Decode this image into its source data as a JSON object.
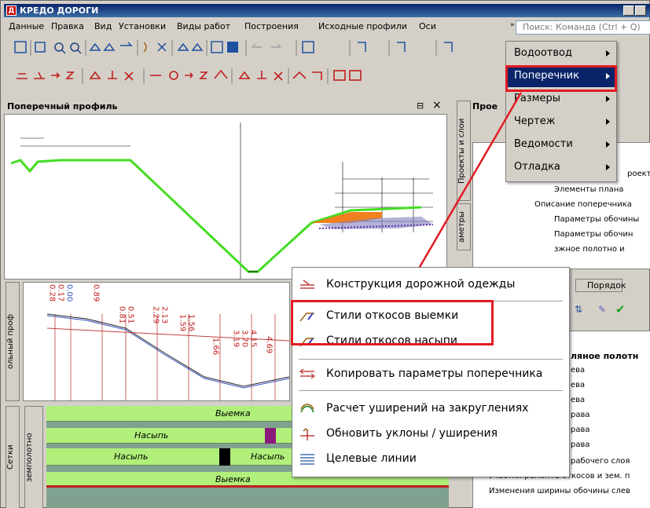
{
  "app": {
    "title": "КРЕДО ДОРОГИ",
    "icon_letter": "Д"
  },
  "menu": [
    "Данные",
    "Правка",
    "Вид",
    "Установки",
    "Виды работ",
    "Построения",
    "Исходные профили",
    "Оси"
  ],
  "search": {
    "placeholder": "Поиск: Команда (Ctrl + Q)"
  },
  "profile_panel": {
    "title": "Поперечный профиль",
    "pin": "⊟",
    "close": "×"
  },
  "right_panel": {
    "title": "Прое",
    "vtab_projects": "Проекты и слои",
    "vtab_params": "аметры",
    "tab_order": "Порядок"
  },
  "tree": {
    "items": [
      "роекта",
      "Элементы плана",
      "Описание поперечника",
      "Параметры обочины",
      "Параметры обочин",
      "зжное полотно и"
    ],
    "lower_items": [
      "ляное полотн",
      "ева",
      "ева",
      "ева",
      "рава",
      "рава",
      "рава",
      "рабочего слоя",
      "Участки ремонта откосов и зем. п",
      "Изменения ширины обочины слев"
    ]
  },
  "dropdown": {
    "items": [
      {
        "label": "Водоотвод",
        "has_sub": true
      },
      {
        "label": "Поперечник",
        "has_sub": true,
        "selected": true
      },
      {
        "label": "Размеры",
        "has_sub": true
      },
      {
        "label": "Чертеж",
        "has_sub": true
      },
      {
        "label": "Ведомости",
        "has_sub": true
      },
      {
        "label": "Отладка",
        "has_sub": true
      }
    ]
  },
  "context_menu": {
    "items": [
      {
        "label": "Конструкция дорожной одежды",
        "icon": "road-layers-icon"
      },
      {
        "label": "Стили откосов выемки",
        "icon": "slope-cut-icon"
      },
      {
        "label": "Стили откосов насыпи",
        "icon": "slope-fill-icon"
      },
      {
        "label": "Копировать параметры поперечника",
        "icon": "copy-params-icon"
      },
      {
        "label": "Расчет уширений на закруглениях",
        "icon": "widening-icon"
      },
      {
        "label": "Обновить уклоны / уширения",
        "icon": "refresh-slopes-icon"
      },
      {
        "label": "Целевые линии",
        "icon": "target-lines-icon"
      }
    ]
  },
  "long_profile": {
    "vtab": "ольный проф",
    "labels": [
      "0.28",
      "0.17",
      "0.00",
      "0.89",
      "0.81",
      "0.51",
      "2.29",
      "2.13",
      "1.59",
      "1.56",
      "1.66",
      "3.19",
      "3.70",
      "4.15",
      "4.69"
    ]
  },
  "grid": {
    "vtab_main": "Сетки",
    "vtab_sub": "земполотно",
    "rows": [
      {
        "left": "",
        "right": "Выемка"
      },
      {
        "left": "Насыпь",
        "right": ""
      },
      {
        "left": "Насыпь",
        "right": "Насыпь"
      },
      {
        "left": "",
        "right": "Выемка"
      }
    ]
  },
  "colors": {
    "highlight": "#e31b23",
    "selection": "#0a246a",
    "green_band": "#b0f07a"
  }
}
